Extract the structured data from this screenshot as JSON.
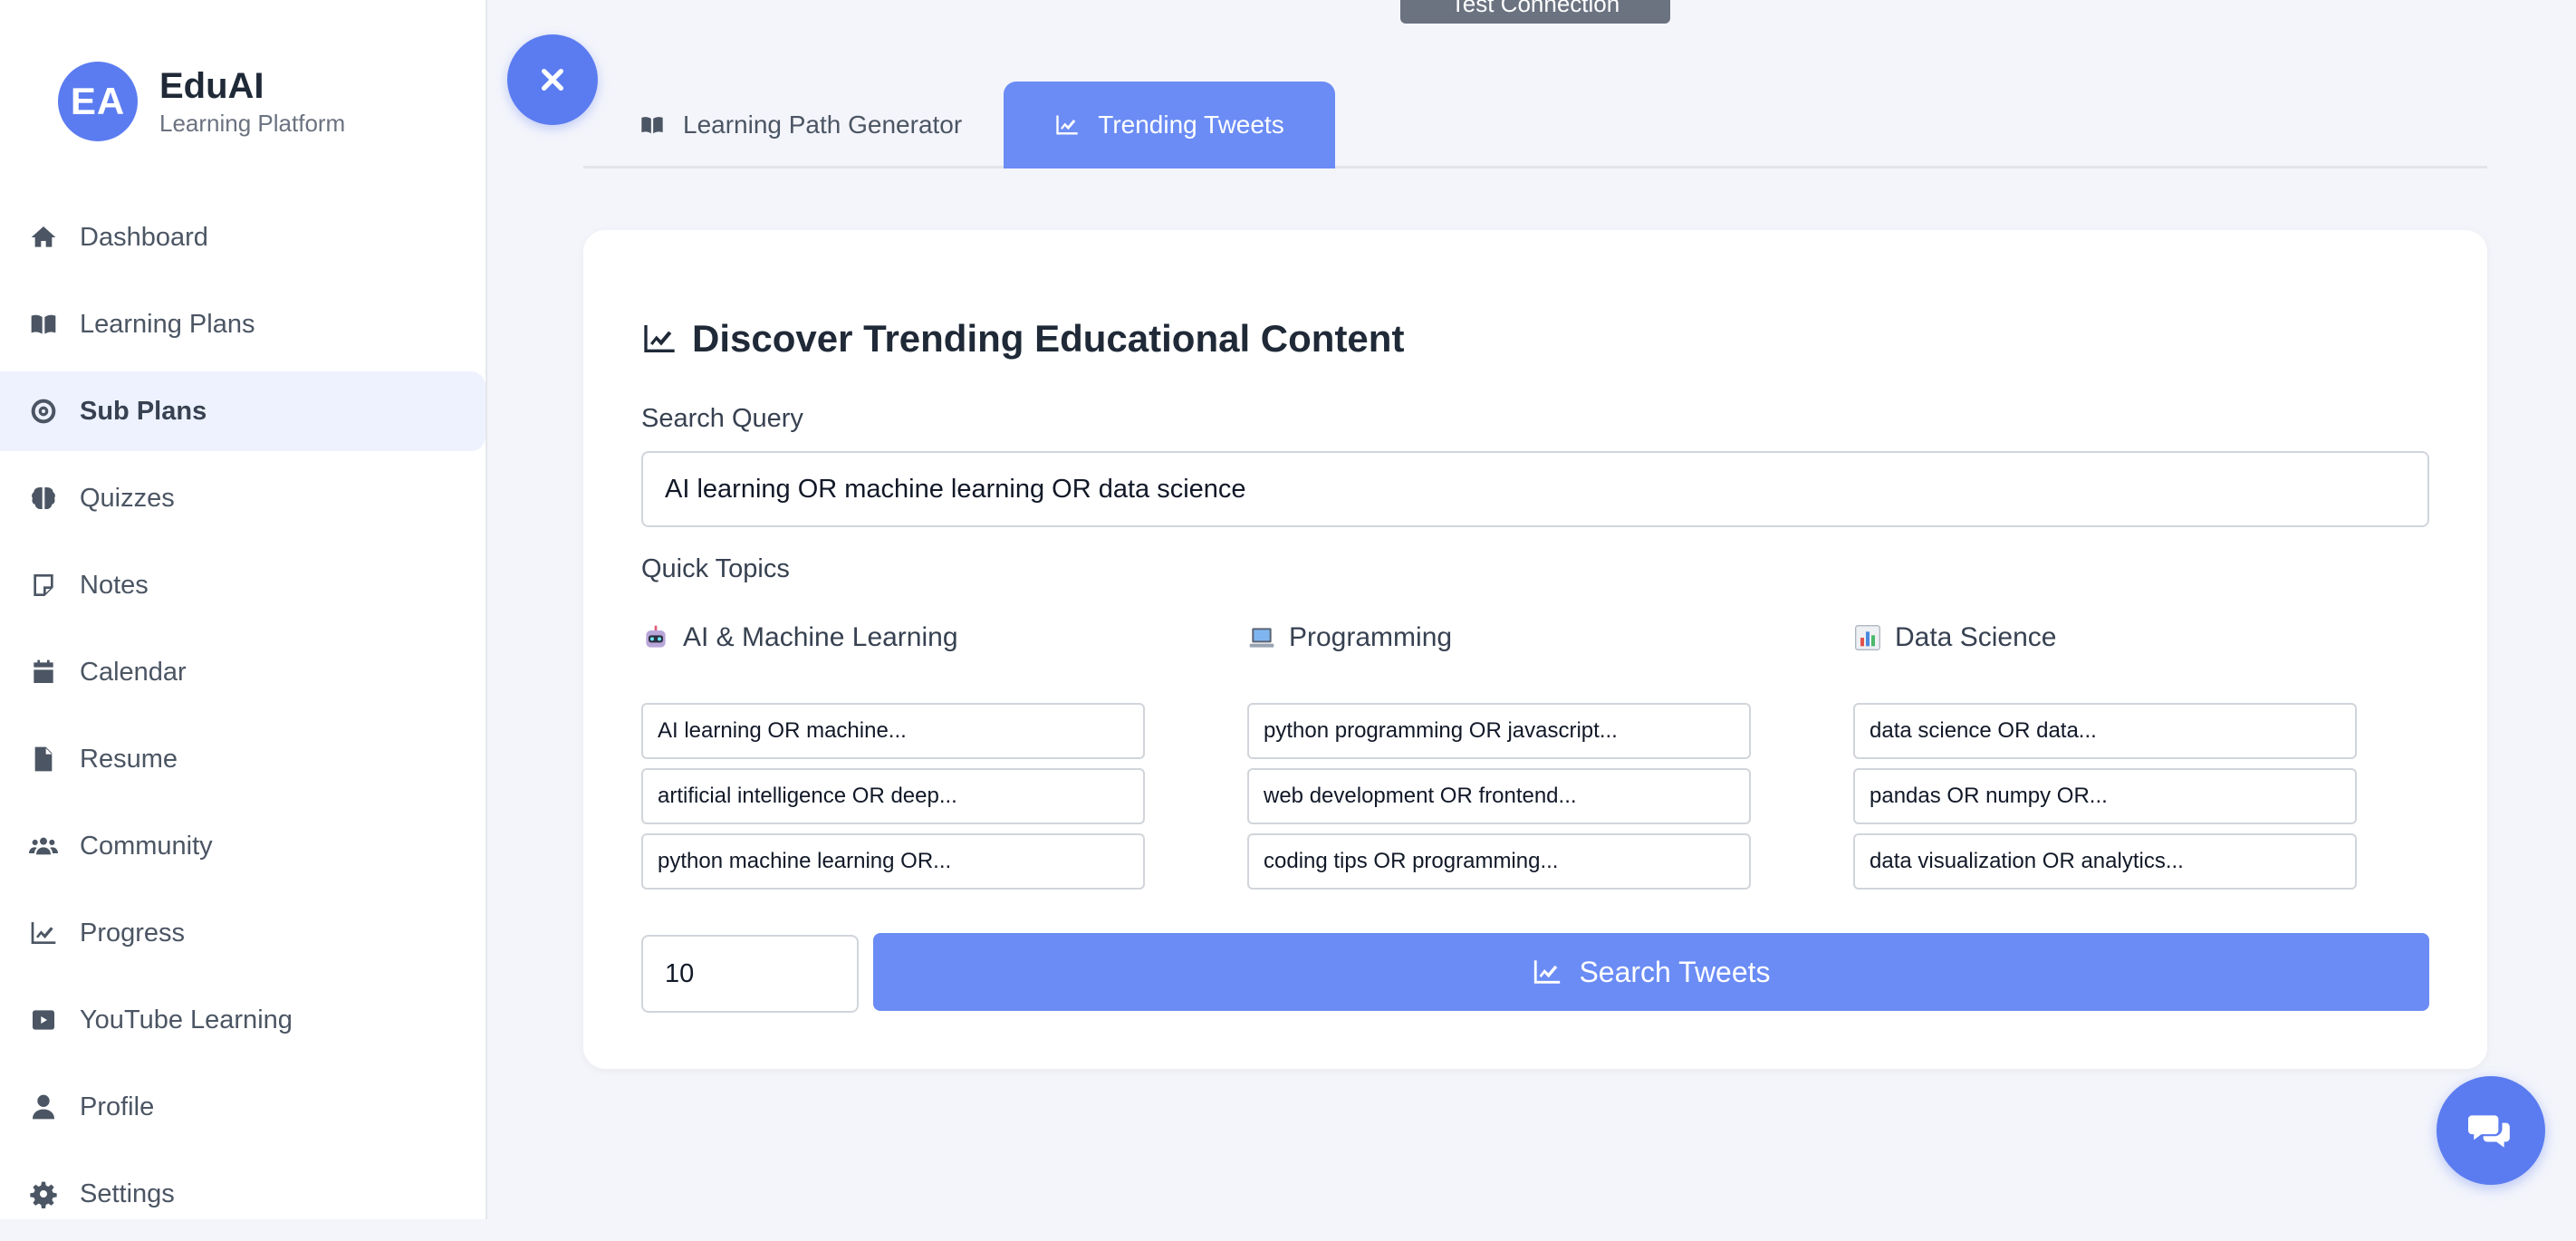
{
  "brand": {
    "initials": "EA",
    "title": "EduAI",
    "subtitle": "Learning Platform"
  },
  "sidebar": {
    "items": [
      {
        "label": "Dashboard",
        "icon": "home-icon"
      },
      {
        "label": "Learning Plans",
        "icon": "book-open-icon"
      },
      {
        "label": "Sub Plans",
        "icon": "target-icon",
        "active": true
      },
      {
        "label": "Quizzes",
        "icon": "brain-icon"
      },
      {
        "label": "Notes",
        "icon": "sticky-note-icon"
      },
      {
        "label": "Calendar",
        "icon": "calendar-icon"
      },
      {
        "label": "Resume",
        "icon": "file-icon"
      },
      {
        "label": "Community",
        "icon": "users-icon"
      },
      {
        "label": "Progress",
        "icon": "chart-line-icon"
      },
      {
        "label": "YouTube Learning",
        "icon": "youtube-icon"
      },
      {
        "label": "Profile",
        "icon": "user-icon"
      },
      {
        "label": "Settings",
        "icon": "gear-icon"
      }
    ]
  },
  "header": {
    "test_connection_label": "Test Connection"
  },
  "tabs": [
    {
      "label": "Learning Path Generator",
      "icon": "book-open-icon",
      "active": false
    },
    {
      "label": "Trending Tweets",
      "icon": "chart-line-icon",
      "active": true
    }
  ],
  "main": {
    "title": "Discover Trending Educational Content",
    "search_label": "Search Query",
    "search_value": "AI learning OR machine learning OR data science",
    "quick_topics_label": "Quick Topics",
    "topics": [
      {
        "emoji": "robot",
        "title": "AI & Machine Learning",
        "chips": [
          "AI learning OR machine...",
          "artificial intelligence OR deep...",
          "python machine learning OR..."
        ]
      },
      {
        "emoji": "laptop",
        "title": "Programming",
        "chips": [
          "python programming OR javascript...",
          "web development OR frontend...",
          "coding tips OR programming..."
        ]
      },
      {
        "emoji": "bar-chart",
        "title": "Data Science",
        "chips": [
          "data science OR data...",
          "pandas OR numpy OR...",
          "data visualization OR analytics..."
        ]
      }
    ],
    "count_value": "10",
    "search_button_label": "Search Tweets"
  },
  "colors": {
    "accent": "#5b7cf0",
    "tab_active": "#6b8cf5",
    "background": "#f4f5fb"
  }
}
